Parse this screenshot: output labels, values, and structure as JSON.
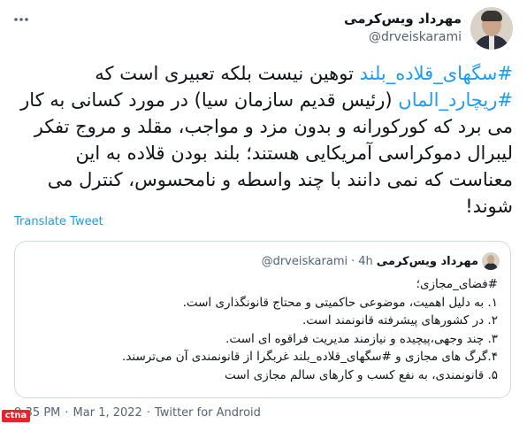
{
  "author": {
    "display_name": "مهرداد ویس‌کرمی",
    "handle": "@drveiskarami"
  },
  "tweet": {
    "segments": [
      {
        "text": "#سگهای_قلاده_بلند",
        "hashtag": true
      },
      {
        "text": " توهین نیست بلکه تعبیری است که ",
        "hashtag": false
      },
      {
        "text": "#ریچارد_الماں",
        "hashtag": true
      },
      {
        "text": " (رئیس قدیم سازمان سیا) در مورد کسانی به کار می برد که کورکورانه و بدون مزد و مواجب، مقلد و مروج تفکر لیبرال دموکراسی آمریکایی هستند؛ بلند بودن قلاده به این معناست که نمی دانند با چند واسطه و نامحسوس، کنترل می شوند!",
        "hashtag": false
      }
    ]
  },
  "translate_label": "Translate Tweet",
  "quote": {
    "display_name": "مهرداد ویس‌کرمی",
    "handle": "@drveiskarami",
    "dot": "·",
    "time": "4h",
    "lines": [
      "#فضای_مجازی؛",
      "۱. به دلیل اهمیت، موضوعی حاکمیتی و محتاج قانونگذاری است.",
      "۲. در کشورهای پیشرفته قانونمند است.",
      "۳. چند وجهی،پیچیده و نیازمند مدیریت فراقوه ای است.",
      "۴.گرگ های مجازی و  #سگهای_قلاده_بلند غربگرا از قانونمندی آن می‌ترسند.",
      "۵. قانونمندی، به نفع کسب و کارهای سالم مجازی است"
    ]
  },
  "footer": {
    "time": "9:35 PM",
    "dot1": "·",
    "date": "Mar 1, 2022",
    "dot2": "·",
    "source": "Twitter for Android"
  },
  "watermark_text": "ctna",
  "colors": {
    "accent": "#1d9bf0",
    "muted": "#536471",
    "border": "#cfd9de"
  },
  "icons": {
    "more": "more-dots-icon"
  }
}
